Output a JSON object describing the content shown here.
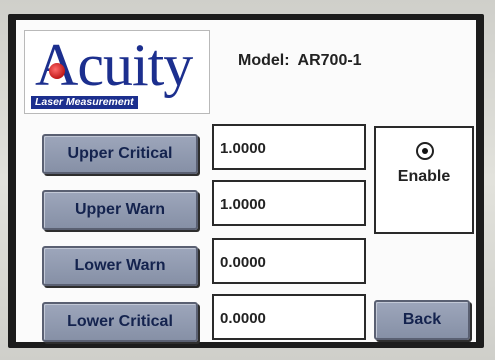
{
  "logo": {
    "word": "Acuity",
    "tagline": "Laser Measurement"
  },
  "header": {
    "model_label": "Model:",
    "model_value": "AR700-1"
  },
  "thresholds": [
    {
      "label": "Upper Critical",
      "value": "1.0000"
    },
    {
      "label": "Upper Warn",
      "value": "1.0000"
    },
    {
      "label": "Lower Warn",
      "value": "0.0000"
    },
    {
      "label": "Lower Critical",
      "value": "0.0000"
    }
  ],
  "enable": {
    "label": "Enable",
    "selected": true
  },
  "back_label": "Back"
}
